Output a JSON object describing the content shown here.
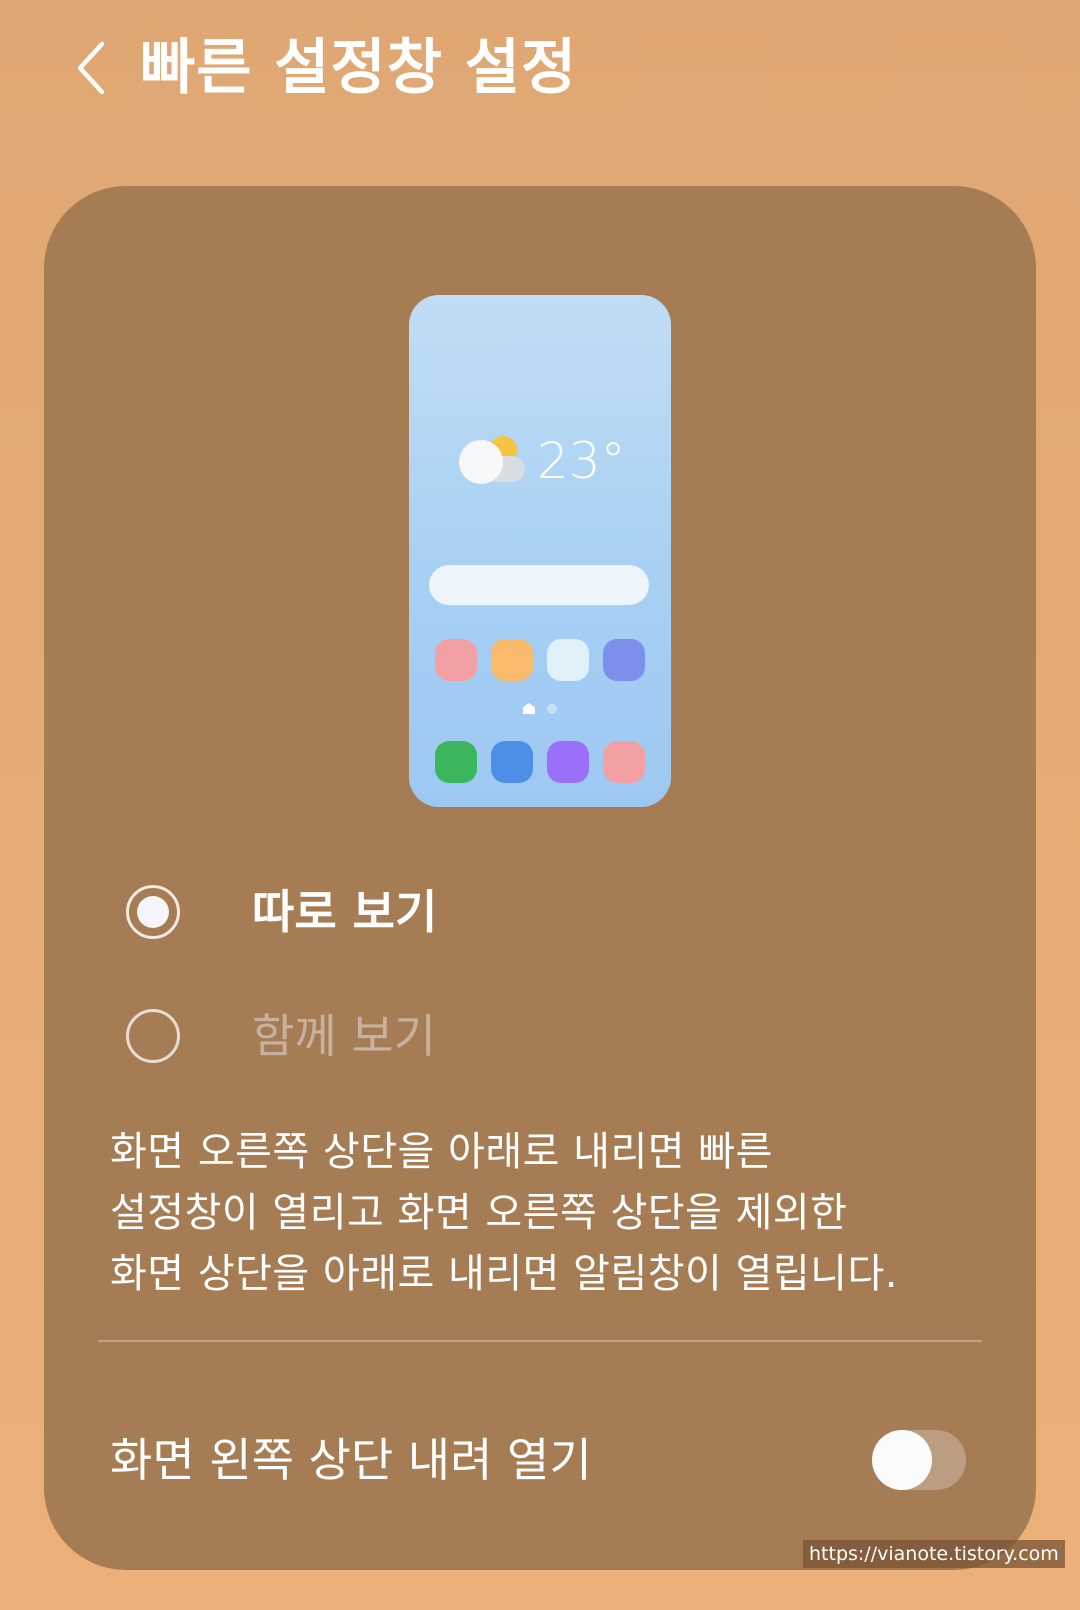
{
  "header": {
    "title": "빠른 설정창 설정",
    "back_icon": "chevron-left-icon"
  },
  "preview": {
    "weather_icon": "partly-cloudy-icon",
    "temperature": "23°",
    "app_colors_row1": [
      "#f2a0a3",
      "#fbbb6d",
      "#e0f1fa",
      "#7b8feb"
    ],
    "app_colors_row2": [
      "#3cb65c",
      "#4d8ee9",
      "#9a6ff9",
      "#f2a0a3"
    ]
  },
  "options": [
    {
      "label": "따로 보기",
      "selected": true
    },
    {
      "label": "함께 보기",
      "selected": false
    }
  ],
  "description": {
    "line1": "화면 오른쪽 상단을 아래로 내리면 빠른",
    "line2": "설정창이 열리고 화면 오른쪽 상단을 제외한",
    "line3": "화면 상단을 아래로 내리면 알림창이 열립니다."
  },
  "toggle": {
    "label": "화면 왼쪽 상단 내려 열기",
    "on": false
  },
  "watermark": "https://vianote.tistory.com",
  "colors": {
    "background": "#e4a872",
    "card": "#a67c54",
    "phone_top": "#c1ddf5",
    "phone_bottom": "#9dc8f2"
  }
}
